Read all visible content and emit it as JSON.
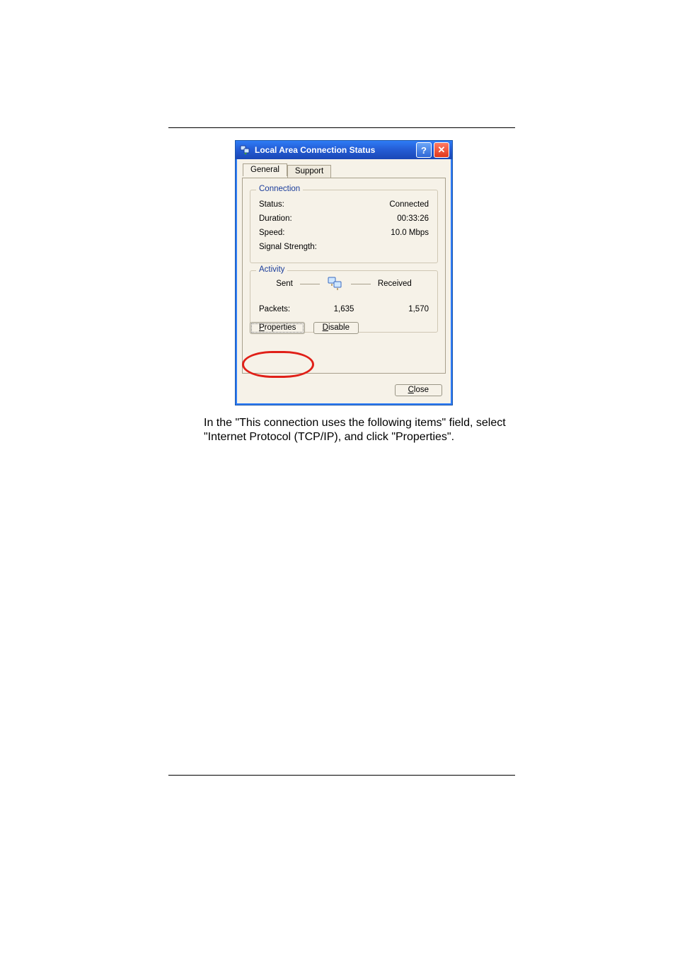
{
  "dialog": {
    "title": "Local Area Connection Status",
    "tabs": {
      "general": "General",
      "support": "Support"
    },
    "groups": {
      "connection_title": "Connection",
      "activity_title": "Activity"
    },
    "labels": {
      "status": "Status:",
      "duration": "Duration:",
      "speed": "Speed:",
      "signal": "Signal Strength:",
      "sent": "Sent",
      "received": "Received",
      "packets": "Packets:"
    },
    "values": {
      "status": "Connected",
      "duration": "00:33:26",
      "speed": "10.0 Mbps",
      "signal": "",
      "sent": "1,635",
      "received": "1,570"
    },
    "buttons": {
      "properties_u": "P",
      "properties_rest": "roperties",
      "disable_u": "D",
      "disable_rest": "isable",
      "close_u": "C",
      "close_rest": "lose"
    }
  },
  "caption": "In the \"This connection uses the following items\" field, select \"Internet Protocol (TCP/IP), and click \"Properties\"."
}
